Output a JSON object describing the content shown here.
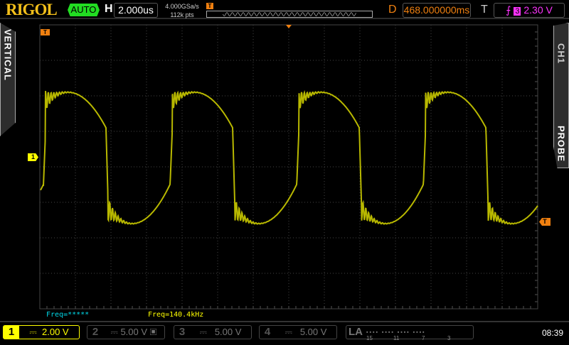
{
  "header": {
    "brand": "RIGOL",
    "run_state": "AUTO",
    "h_label": "H",
    "timebase": "2.000us",
    "sample_rate": "4.000GSa/s",
    "memory_depth": "112k pts",
    "trigger_marker": "T",
    "delay_label": "D",
    "delay": "468.000000ms",
    "trigger_label": "T",
    "trigger_source": "3",
    "trigger_level": "2.30 V",
    "trigger_edge_icon": "rising-edge-icon"
  },
  "side": {
    "left": "VERTICAL",
    "right_top": "CH1",
    "right_bottom": "PROBE"
  },
  "markers": {
    "ch1": "1",
    "trigger": "T"
  },
  "measurements": [
    {
      "text": "Freq=*****",
      "color": "#00d8e8"
    },
    {
      "text": "Freq=140.4kHz",
      "color": "#ffff00"
    }
  ],
  "signal": {
    "frequency_khz": 140.4,
    "timebase_us_per_div": 2.0,
    "color": "#b8b800"
  },
  "channels": [
    {
      "num": "1",
      "coupling": "⎓",
      "scale": "2.00 V",
      "active": true,
      "color": "#ffff00"
    },
    {
      "num": "2",
      "coupling": "⎓",
      "scale": "5.00 V",
      "active": false,
      "color": "#555555"
    },
    {
      "num": "3",
      "coupling": "⎓",
      "scale": "5.00 V",
      "active": false,
      "color": "#555555"
    },
    {
      "num": "4",
      "coupling": "⎓",
      "scale": "5.00 V",
      "active": false,
      "color": "#555555"
    }
  ],
  "la": {
    "label": "LA",
    "groups": [
      "15",
      "11",
      "7",
      "3"
    ]
  },
  "clock": "08:39"
}
